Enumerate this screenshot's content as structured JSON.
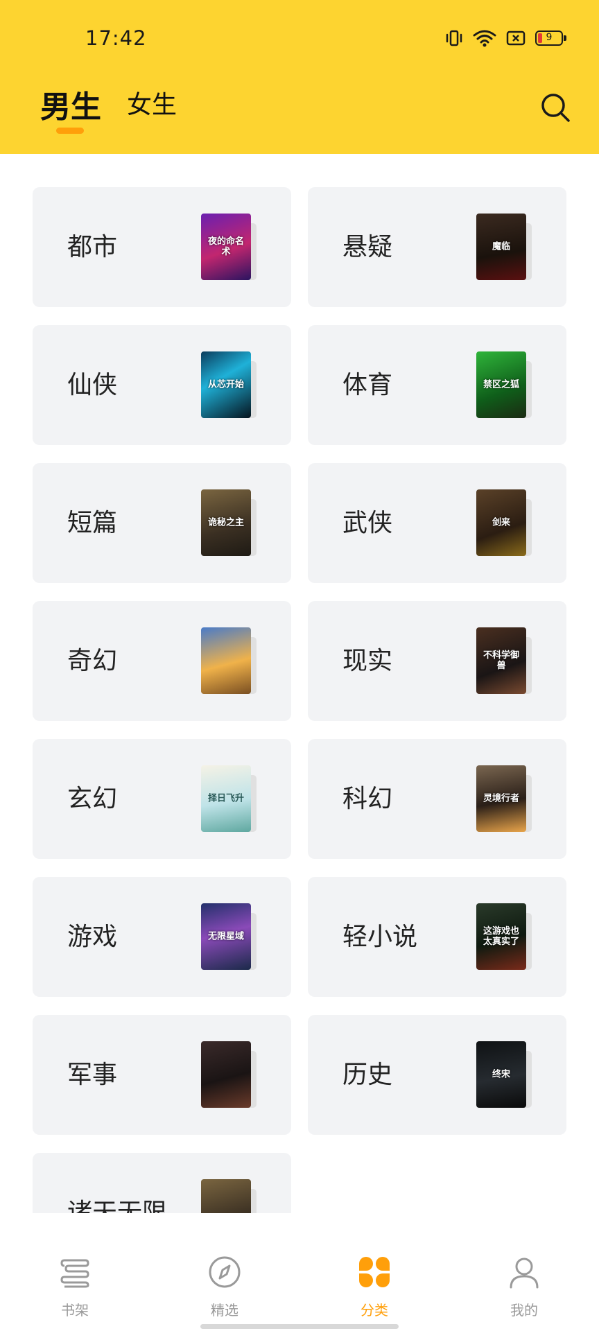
{
  "status_bar": {
    "time": "17:42",
    "battery_level": "9"
  },
  "header": {
    "tabs": [
      {
        "label": "男生",
        "active": true
      },
      {
        "label": "女生",
        "active": false
      }
    ],
    "search_icon": "search-icon",
    "accent_color": "#ff9f0a",
    "background_color": "#fdd430"
  },
  "categories": [
    {
      "label": "都市",
      "cover_title": "夜的命名术"
    },
    {
      "label": "悬疑",
      "cover_title": "魔临"
    },
    {
      "label": "仙侠",
      "cover_title": "从芯开始"
    },
    {
      "label": "体育",
      "cover_title": "禁区之狐"
    },
    {
      "label": "短篇",
      "cover_title": "诡秘之主"
    },
    {
      "label": "武侠",
      "cover_title": "剑来"
    },
    {
      "label": "奇幻",
      "cover_title": ""
    },
    {
      "label": "现实",
      "cover_title": "不科学御兽"
    },
    {
      "label": "玄幻",
      "cover_title": "择日飞升"
    },
    {
      "label": "科幻",
      "cover_title": "灵境行者"
    },
    {
      "label": "游戏",
      "cover_title": "无限星域"
    },
    {
      "label": "轻小说",
      "cover_title": "这游戏也太真实了"
    },
    {
      "label": "军事",
      "cover_title": ""
    },
    {
      "label": "历史",
      "cover_title": "终宋"
    },
    {
      "label": "诸天无限",
      "cover_title": ""
    }
  ],
  "bottom_nav": {
    "items": [
      {
        "label": "书架",
        "icon": "bookshelf-icon",
        "active": false
      },
      {
        "label": "精选",
        "icon": "compass-icon",
        "active": false
      },
      {
        "label": "分类",
        "icon": "category-icon",
        "active": true
      },
      {
        "label": "我的",
        "icon": "user-icon",
        "active": false
      }
    ]
  }
}
